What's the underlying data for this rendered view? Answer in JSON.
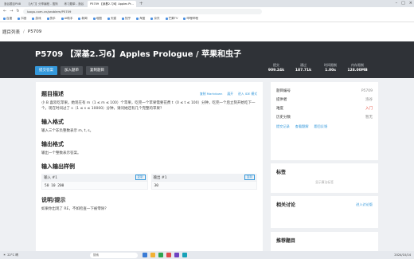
{
  "browser": {
    "tabs": [
      {
        "label": "洛谷题目PNB",
        "active": false
      },
      {
        "label": "【大门】分享编程 - 搜狗",
        "active": false
      },
      {
        "label": "练习题单 - 洛谷",
        "active": false
      },
      {
        "label": "P5709 【深基2.习6】Apples Pr...",
        "active": true
      }
    ],
    "url": "luogu.com.cn/problem/P5709",
    "bookmarks": [
      "百度",
      "抖音",
      "游戏",
      "快手",
      "AI助手",
      "新闻",
      "地图",
      "天猫",
      "知乎",
      "淘宝",
      "京东",
      "芒果TV",
      "哔哩哔哩"
    ]
  },
  "breadcrumb": {
    "parent": "题目列表",
    "current": "P5709"
  },
  "header": {
    "title": "P5709 【深基2.习6】Apples Prologue / 苹果和虫子",
    "buttons": {
      "submit": "提交答案",
      "add_list": "加入题单",
      "copy": "复制题目"
    },
    "stats": [
      {
        "label": "提交",
        "value": "909.24k"
      },
      {
        "label": "通过",
        "value": "187.71k"
      },
      {
        "label": "时间限制",
        "value": "1.00s"
      },
      {
        "label": "内存限制",
        "value": "128.00MB"
      }
    ]
  },
  "problem": {
    "desc_title": "题目描述",
    "links": {
      "markdown": "复制 Markdown",
      "expand": "展开",
      "ide": "进入 IDE 模式"
    },
    "description": "小 B 喜欢吃苹果。她现在有 m（1 ≤ m ≤ 100）个苹果，吃完一个苹果需要花费 t（0 ≤ t ≤ 100）分钟，吃完一个后立刻开始吃下一个。现在时间过了 s（1 ≤ s ≤ 10000）分钟，请问她还有几个完整的苹果？",
    "input_title": "输入格式",
    "input_text": "输入三个非负整数表示 m, t, s。",
    "output_title": "输出格式",
    "output_text": "输出一个整数表示答案。",
    "samples_title": "输入输出样例",
    "sample_input_label": "输入 #1",
    "sample_output_label": "输出 #1",
    "copy_label": "复制",
    "sample_input": "50 10 200",
    "sample_output": "30",
    "hint_title": "说明/提示",
    "hint_text": "如果你出现了 RE，不如检查一下被零除？"
  },
  "sidebar": {
    "info": [
      {
        "label": "题目编号",
        "value": "P5709"
      },
      {
        "label": "提供者",
        "value": "洛谷"
      },
      {
        "label": "难度",
        "value": "入门"
      },
      {
        "label": "历史分数",
        "value": "暂无"
      }
    ],
    "actions": [
      "提交记录",
      "查看题解",
      "题目反馈"
    ],
    "tags_title": "标签",
    "tags_hint": "显示算法标签",
    "discuss_title": "相关讨论",
    "discuss_link": "进入讨论版",
    "recommend_title": "推荐题目"
  },
  "taskbar": {
    "weather": "22°C 晴",
    "search": "搜索",
    "time": "2024/10/14"
  },
  "colors": {
    "accent": "#3498db",
    "header_bg": "#2f3237",
    "difficulty": "#e74c3c"
  }
}
